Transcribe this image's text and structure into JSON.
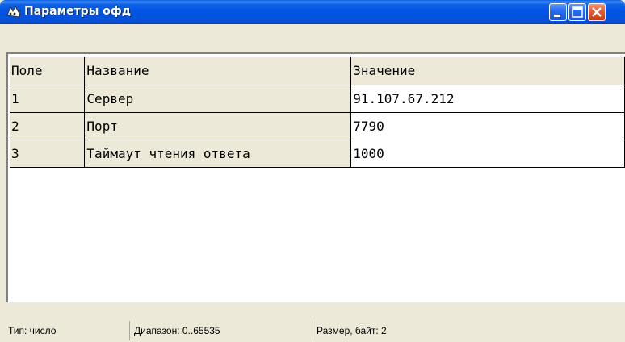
{
  "window": {
    "title": "Параметры офд",
    "icon": "app-icon",
    "controls": [
      "minimize-icon",
      "maximize-icon",
      "close-icon"
    ]
  },
  "grid": {
    "headers": [
      "Поле",
      "Название",
      "Значение"
    ],
    "rows": [
      {
        "field": "1",
        "name": "Сервер",
        "value": "91.107.67.212"
      },
      {
        "field": "2",
        "name": "Порт",
        "value": "7790"
      },
      {
        "field": "3",
        "name": "Таймаут чтения ответа",
        "value": "1000"
      }
    ]
  },
  "statusbar": {
    "type": "Тип: число",
    "range": "Диапазон: 0..65535",
    "size": "Размер, байт: 2"
  },
  "colors": {
    "titlebar": "#0054e3",
    "window_bg": "#ece9d8",
    "grid_bg": "#ffffff"
  }
}
